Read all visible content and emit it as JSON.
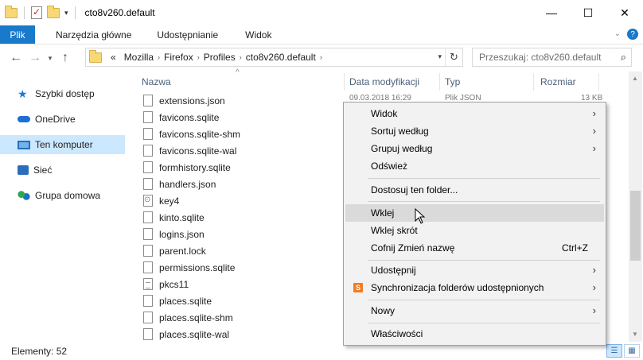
{
  "window": {
    "title": "cto8v260.default",
    "minimize": "—",
    "maximize": "☐",
    "close": "✕"
  },
  "ribbon": {
    "tabs": [
      "Plik",
      "Narzędzia główne",
      "Udostępnianie",
      "Widok"
    ]
  },
  "address": {
    "overflow": "«",
    "crumbs": [
      "Mozilla",
      "Firefox",
      "Profiles",
      "cto8v260.default"
    ],
    "search_placeholder": "Przeszukaj: cto8v260.default"
  },
  "nav": {
    "items": [
      {
        "label": "Szybki dostęp",
        "icon": "star-icon"
      },
      {
        "label": "OneDrive",
        "icon": "cloud-icon"
      },
      {
        "label": "Ten komputer",
        "icon": "computer-icon",
        "selected": true
      },
      {
        "label": "Sieć",
        "icon": "network-icon"
      },
      {
        "label": "Grupa domowa",
        "icon": "homegroup-icon"
      }
    ]
  },
  "columns": {
    "name": "Nazwa",
    "modified": "Data modyfikacji",
    "type": "Typ",
    "size": "Rozmiar"
  },
  "first_row_partial": {
    "modified": "09.03.2018 16:29",
    "type": "Plik JSON",
    "size": "13 KB"
  },
  "files": [
    {
      "name": "extensions.json",
      "icon": "file-icon"
    },
    {
      "name": "favicons.sqlite",
      "icon": "file-icon"
    },
    {
      "name": "favicons.sqlite-shm",
      "icon": "file-icon"
    },
    {
      "name": "favicons.sqlite-wal",
      "icon": "file-icon"
    },
    {
      "name": "formhistory.sqlite",
      "icon": "file-icon"
    },
    {
      "name": "handlers.json",
      "icon": "file-icon"
    },
    {
      "name": "key4",
      "icon": "key-file-icon"
    },
    {
      "name": "kinto.sqlite",
      "icon": "file-icon"
    },
    {
      "name": "logins.json",
      "icon": "file-icon"
    },
    {
      "name": "parent.lock",
      "icon": "file-icon"
    },
    {
      "name": "permissions.sqlite",
      "icon": "file-icon"
    },
    {
      "name": "pkcs11",
      "icon": "text-file-icon"
    },
    {
      "name": "places.sqlite",
      "icon": "file-icon"
    },
    {
      "name": "places.sqlite-shm",
      "icon": "file-icon"
    },
    {
      "name": "places.sqlite-wal",
      "icon": "file-icon"
    }
  ],
  "context_menu": {
    "items": [
      {
        "label": "Widok",
        "submenu": true
      },
      {
        "label": "Sortuj według",
        "submenu": true
      },
      {
        "label": "Grupuj według",
        "submenu": true
      },
      {
        "label": "Odśwież"
      },
      {
        "label": "Dostosuj ten folder..."
      },
      {
        "label": "Wklej",
        "highlighted": true
      },
      {
        "label": "Wklej skrót"
      },
      {
        "label": "Cofnij Zmień nazwę",
        "shortcut": "Ctrl+Z"
      },
      {
        "label": "Udostępnij",
        "submenu": true
      },
      {
        "label": "Synchronizacja folderów udostępnionych",
        "submenu": true,
        "icon": "sync-icon"
      },
      {
        "label": "Nowy",
        "submenu": true
      },
      {
        "label": "Właściwości"
      }
    ]
  },
  "status": {
    "items_count": "Elementy: 52"
  }
}
